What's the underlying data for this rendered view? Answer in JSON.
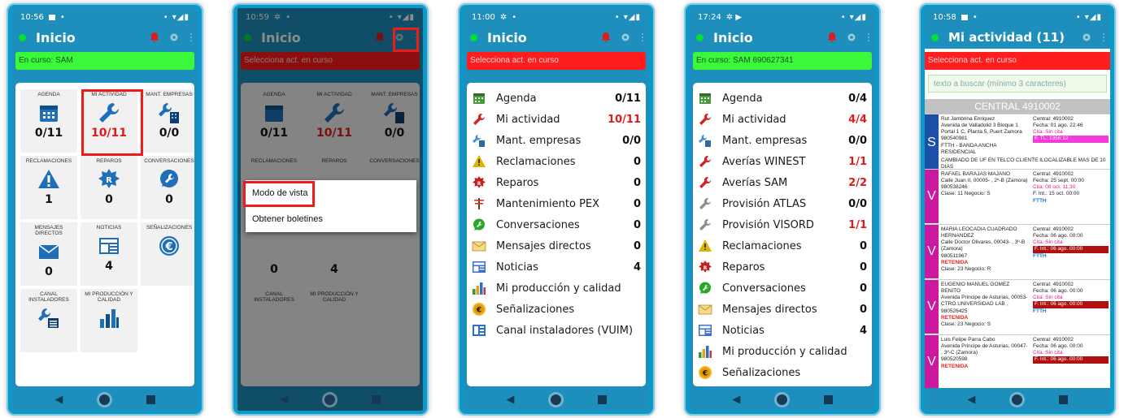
{
  "phones": [
    {
      "time": "10:56",
      "signal": "• ▾◢▮",
      "app_title": "Inicio",
      "banner": "En curso: SAM",
      "tiles": [
        {
          "label": "AGENDA",
          "value": "0/11",
          "icon": "calendar-icon"
        },
        {
          "label": "MI ACTIVIDAD",
          "value": "10/11",
          "icon": "wrench-icon"
        },
        {
          "label": "MANT. EMPRESAS",
          "value": "0/0",
          "icon": "wrench-building-icon"
        },
        {
          "label": "RECLAMACIONES",
          "value": "1",
          "icon": "warning-icon"
        },
        {
          "label": "REPAROS",
          "value": "0",
          "icon": "repair-badge-icon"
        },
        {
          "label": "CONVERSACIONES",
          "value": "0",
          "icon": "chat-wrench-icon"
        },
        {
          "label": "MENSAJES DIRECTOS",
          "value": "0",
          "icon": "mail-icon"
        },
        {
          "label": "NOTICIAS",
          "value": "4",
          "icon": "news-icon"
        },
        {
          "label": "SEÑALIZACIONES",
          "value": "",
          "icon": "euro-icon"
        },
        {
          "label": "CANAL INSTALADORES",
          "value": "",
          "icon": "installer-channel-icon"
        },
        {
          "label": "MI PRODUCCIÓN Y CALIDAD",
          "value": "",
          "icon": "bar-chart-icon"
        }
      ]
    },
    {
      "time": "10:59",
      "signal": "• ▾◢▮",
      "app_title": "Inicio",
      "banner": "Selecciona act. en curso",
      "menu": [
        "Modo de vista",
        "Obtener boletines"
      ]
    },
    {
      "time": "11:00",
      "signal": "• ▾◢▮",
      "app_title": "Inicio",
      "banner": "Selecciona act. en curso",
      "rows": [
        {
          "label": "Agenda",
          "value": "0/11",
          "icon": "calendar-icon"
        },
        {
          "label": "Mi actividad",
          "value": "10/11",
          "icon": "wrench-icon",
          "red": true
        },
        {
          "label": "Mant. empresas",
          "value": "0/0",
          "icon": "wrench-building-icon"
        },
        {
          "label": "Reclamaciones",
          "value": "0",
          "icon": "warning-icon"
        },
        {
          "label": "Reparos",
          "value": "0",
          "icon": "repair-badge-icon"
        },
        {
          "label": "Mantenimiento PEX",
          "value": "0",
          "icon": "pole-icon"
        },
        {
          "label": "Conversaciones",
          "value": "0",
          "icon": "chat-wrench-icon"
        },
        {
          "label": "Mensajes directos",
          "value": "0",
          "icon": "mail-icon"
        },
        {
          "label": "Noticias",
          "value": "4",
          "icon": "news-icon"
        },
        {
          "label": "Mi producción y calidad",
          "value": "",
          "icon": "bar-chart-icon"
        },
        {
          "label": "Señalizaciones",
          "value": "",
          "icon": "euro-icon"
        },
        {
          "label": "Canal instaladores (VUIM)",
          "value": "",
          "icon": "installer-channel-icon"
        }
      ]
    },
    {
      "time": "17:24",
      "signal": "• ▾◢▮",
      "app_title": "Inicio",
      "banner": "En curso: SAM 690627341",
      "rows": [
        {
          "label": "Agenda",
          "value": "0/4",
          "icon": "calendar-icon"
        },
        {
          "label": "Mi actividad",
          "value": "4/4",
          "icon": "wrench-icon",
          "red": true
        },
        {
          "label": "Mant. empresas",
          "value": "0/0",
          "icon": "wrench-building-icon"
        },
        {
          "label": "Averías WINEST",
          "value": "1/1",
          "icon": "wrench-icon",
          "red": true
        },
        {
          "label": "Averías SAM",
          "value": "2/2",
          "icon": "wrench-icon",
          "red": true
        },
        {
          "label": "Provisión ATLAS",
          "value": "0/0",
          "icon": "wrench-grey-icon"
        },
        {
          "label": "Provisión VISORD",
          "value": "1/1",
          "icon": "wrench-grey-icon",
          "red": true
        },
        {
          "label": "Reclamaciones",
          "value": "0",
          "icon": "warning-icon"
        },
        {
          "label": "Reparos",
          "value": "0",
          "icon": "repair-badge-icon"
        },
        {
          "label": "Conversaciones",
          "value": "0",
          "icon": "chat-wrench-icon"
        },
        {
          "label": "Mensajes directos",
          "value": "0",
          "icon": "mail-icon"
        },
        {
          "label": "Noticias",
          "value": "4",
          "icon": "news-icon"
        },
        {
          "label": "Mi producción y calidad",
          "value": "",
          "icon": "bar-chart-icon"
        },
        {
          "label": "Señalizaciones",
          "value": "",
          "icon": "euro-icon"
        }
      ]
    },
    {
      "time": "10:58",
      "signal": "• ▾◢▮",
      "app_title": "Mi actividad (11)",
      "banner": "Selecciona act. en curso",
      "search_placeholder": "texto a buscar (mínimo 3 caracteres)",
      "central_header": "CENTRAL 4910002",
      "items": [
        {
          "letter": "S",
          "color": "#1b4fa8",
          "l": [
            "Rut Jambrina Enriquez",
            "Avenida de Valladolid 3 Bloque 1 Portal 1 C, Planta 5, Puert Zamora",
            "980540981",
            "FTTH - BANDA ANCHA RESIDENCIAL"
          ],
          "r": [
            "Central: 4910002",
            "Fecha: 01 ago. 22:46",
            "Cita: Sin cita",
            "F. Tt.: 1356:12"
          ],
          "note": "CAMBIADO DE UF EN TELCO CLIENTE ILOCALIZABLE MAS DE 10 DIAS"
        },
        {
          "letter": "V",
          "color": "#cc1aa0",
          "l": [
            "RAFAEL BARAJAS MAJANO",
            "Calle Juan II, 00005- , 2º-B (Zamora)",
            "980538246",
            "Clase: 11 Negocio: S"
          ],
          "r": [
            "Central: 4910002",
            "Fecha: 25 sept. 00:00",
            "Cita: 08 oct. 11:30",
            "F. Int.: 15 oct. 00:00",
            "FTTH"
          ]
        },
        {
          "letter": "V",
          "color": "#cc1aa0",
          "l": [
            "MARIA LEOCADIA CUADRADO HERNANDEZ",
            "Calle Doctor Olivares, 00043- , 3º-B (Zamora)",
            "980511967",
            "RETENIDA",
            "Clase: 23 Negocio: R"
          ],
          "r": [
            "Central: 4910002",
            "Fecha: 06 ago. 00:00",
            "Cita: Sin cita",
            "F. Int.: 06 ago. 00:00",
            "FTTH"
          ]
        },
        {
          "letter": "V",
          "color": "#cc1aa0",
          "l": [
            "EUGENIO MANUEL GOMEZ BENITO",
            "Avenida Principe de Asturias, 00053-CTRO.UNIVERSIDAD LAB ,",
            "980526425",
            "RETENIDA",
            "Clase: 23 Negocio: S"
          ],
          "r": [
            "Central: 4910002",
            "Fecha: 06 ago. 00:00",
            "Cita: Sin cita",
            "F. Int.: 06 ago. 00:00",
            "FTTH"
          ]
        },
        {
          "letter": "V",
          "color": "#cc1aa0",
          "l": [
            "Luis Felipe Parra Cabo",
            "Avenida Principe de Asturias, 00047- , 3º-C (Zamora)",
            "980520598",
            "RETENIDA"
          ],
          "r": [
            "Central: 4910002",
            "Fecha: 06 ago. 00:00",
            "Cita: Sin cita",
            "F. Int.: 06 ago. 00:00"
          ]
        }
      ]
    }
  ],
  "colors": {
    "accent": "#0e98c8",
    "red": "#e01b1b",
    "green": "#3bf83b",
    "bell": "#e01b1b"
  }
}
